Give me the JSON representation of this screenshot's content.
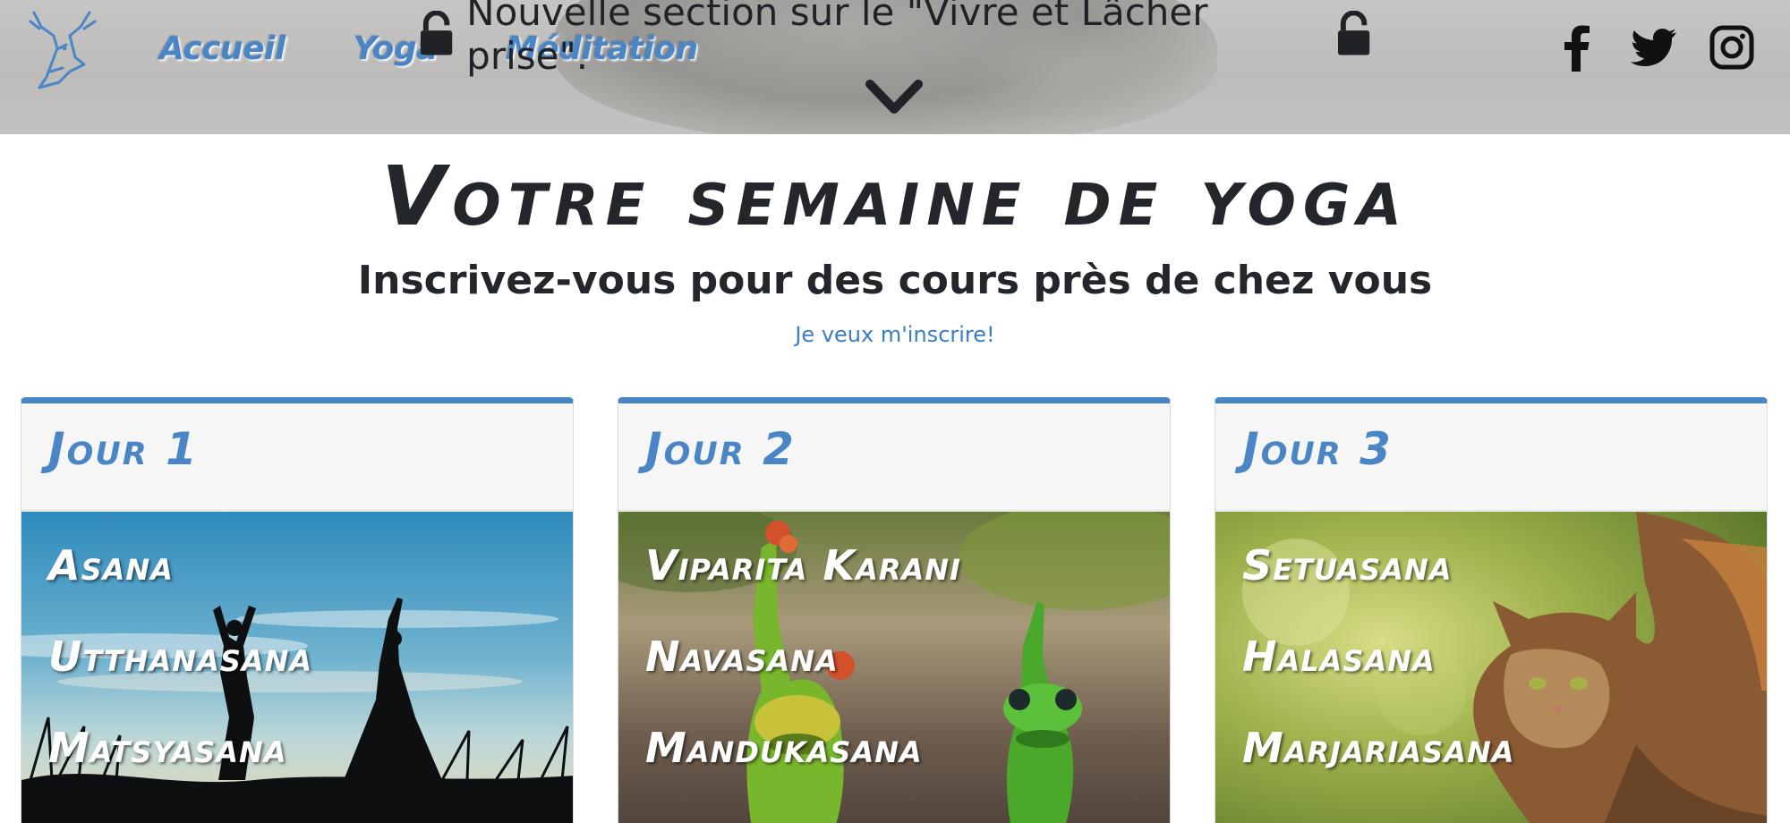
{
  "header": {
    "announcement": "Nouvelle section sur le \"Vivre et Lâcher prise\".",
    "nav": [
      "Accueil",
      "Yoga",
      "Méditation"
    ],
    "social": [
      "facebook-icon",
      "twitter-icon",
      "instagram-icon"
    ]
  },
  "hero": {
    "title": "Votre semaine de yoga",
    "subtitle": "Inscrivez-vous pour des cours près de chez vous",
    "signup_link": "Je veux m'inscrire!"
  },
  "days": [
    {
      "title": "Jour 1",
      "poses": [
        "Asana",
        "Utthanasana",
        "Matsyasana"
      ]
    },
    {
      "title": "Jour 2",
      "poses": [
        "Viparita Karani",
        "Navasana",
        "Mandukasana"
      ]
    },
    {
      "title": "Jour 3",
      "poses": [
        "Setuasana",
        "Halasana",
        "Marjariasana"
      ]
    }
  ],
  "colors": {
    "accent": "#4a86c5",
    "text": "#212529",
    "header_bg": "#c0bfbd"
  }
}
